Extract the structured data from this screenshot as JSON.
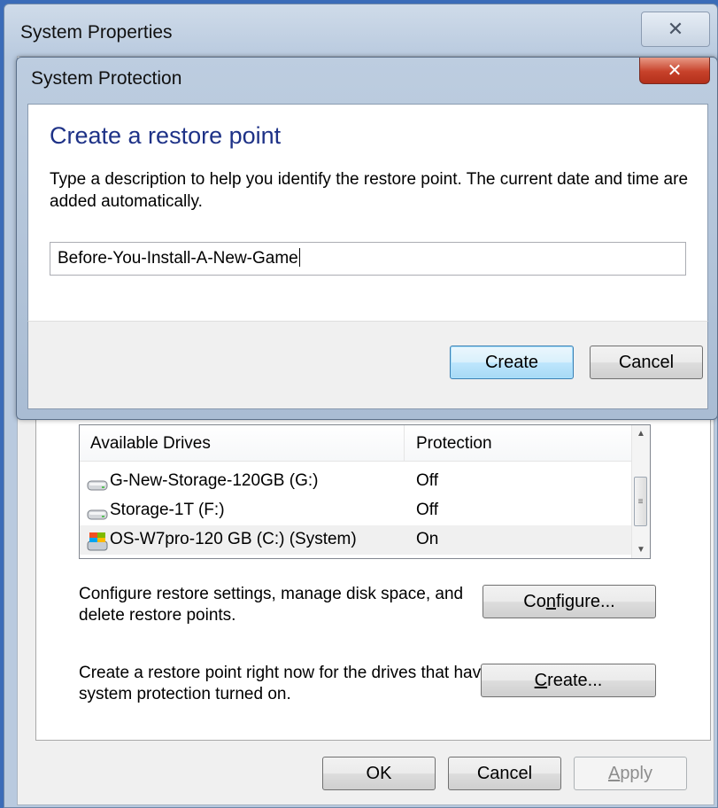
{
  "system_properties": {
    "title": "System Properties",
    "close_glyph": "✕",
    "drives_list": {
      "headers": {
        "name": "Available Drives",
        "protection": "Protection"
      },
      "rows": [
        {
          "name": "G-New-Storage-120GB (G:)",
          "protection": "Off",
          "icon": "hard-drive-icon"
        },
        {
          "name": "Storage-1T (F:)",
          "protection": "Off",
          "icon": "hard-drive-icon"
        },
        {
          "name": "OS-W7pro-120 GB (C:) (System)",
          "protection": "On",
          "icon": "system-drive-icon",
          "selected": true
        }
      ]
    },
    "configure_text": "Configure restore settings, manage disk space, and delete restore points.",
    "configure_button": {
      "pre": "Co",
      "mnemonic": "n",
      "post": "figure..."
    },
    "create_text": "Create a restore point right now for the drives that have system protection turned on.",
    "create_button": {
      "mnemonic": "C",
      "post": "reate..."
    },
    "ok_button": "OK",
    "cancel_button": "Cancel",
    "apply_button": {
      "mnemonic": "A",
      "post": "pply"
    }
  },
  "system_protection": {
    "title": "System Protection",
    "close_glyph": "✕",
    "heading": "Create a restore point",
    "description": "Type a description to help you identify the restore point. The current date and time are added automatically.",
    "input_value": "Before-You-Install-A-New-Game",
    "create_button": "Create",
    "cancel_button": "Cancel"
  },
  "colors": {
    "desktop": "#3b6cb8",
    "heading": "#1e3287",
    "close_red": "#c7412a"
  }
}
